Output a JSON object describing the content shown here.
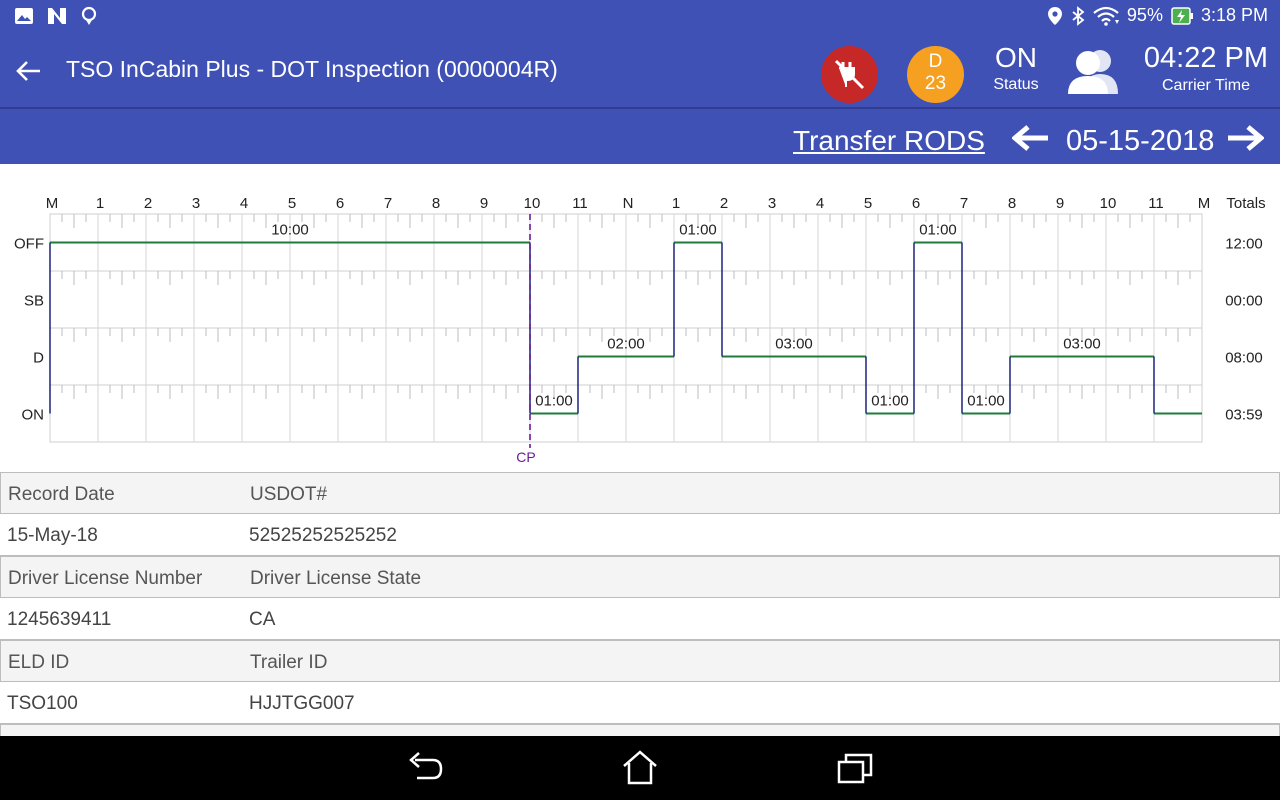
{
  "status_bar": {
    "left_icons": [
      "image-icon",
      "n-logo-icon",
      "location-pin-outline-icon"
    ],
    "battery": "95%",
    "time": "3:18 PM"
  },
  "app_bar": {
    "title": "TSO InCabin Plus - DOT Inspection (0000004R)",
    "duty_badge_top": "D",
    "duty_badge_bottom": "23",
    "status_value": "ON",
    "status_caption": "Status",
    "carrier_time": "04:22 PM",
    "carrier_caption": "Carrier Time"
  },
  "sub_bar": {
    "transfer_label": "Transfer RODS",
    "date": "05-15-2018"
  },
  "colors": {
    "primary": "#3f51b5",
    "alert": "#c62828",
    "duty_badge": "#f5a020",
    "line": "#1e7b3c",
    "vertical": "#1a237e",
    "cp_line": "#6a1b9a"
  },
  "chart_data": {
    "type": "line",
    "hour_labels": [
      "M",
      "1",
      "2",
      "3",
      "4",
      "5",
      "6",
      "7",
      "8",
      "9",
      "10",
      "11",
      "N",
      "1",
      "2",
      "3",
      "4",
      "5",
      "6",
      "7",
      "8",
      "9",
      "10",
      "11",
      "M"
    ],
    "totals_label": "Totals",
    "rows": [
      "OFF",
      "SB",
      "D",
      "ON"
    ],
    "totals": [
      "12:00",
      "00:00",
      "08:00",
      "03:59"
    ],
    "segments": [
      {
        "status": "OFF",
        "start": 0,
        "end": 10,
        "label": "10:00"
      },
      {
        "status": "ON",
        "start": 10,
        "end": 11,
        "label": "01:00"
      },
      {
        "status": "D",
        "start": 11,
        "end": 13,
        "label": "02:00"
      },
      {
        "status": "OFF",
        "start": 13,
        "end": 14,
        "label": "01:00"
      },
      {
        "status": "D",
        "start": 14,
        "end": 17,
        "label": "03:00"
      },
      {
        "status": "ON",
        "start": 17,
        "end": 18,
        "label": "01:00"
      },
      {
        "status": "OFF",
        "start": 18,
        "end": 19,
        "label": "01:00"
      },
      {
        "status": "ON",
        "start": 19,
        "end": 20,
        "label": "01:00"
      },
      {
        "status": "D",
        "start": 20,
        "end": 23,
        "label": "03:00"
      },
      {
        "status": "ON",
        "start": 23,
        "end": 24,
        "label": ""
      }
    ],
    "marker": {
      "hour": 10,
      "label": "CP"
    }
  },
  "info": {
    "record_date_label": "Record Date",
    "usdot_label": "USDOT#",
    "record_date": "15-May-18",
    "usdot": "52525252525252",
    "license_number_label": "Driver License Number",
    "license_state_label": "Driver License State",
    "license_number": "1245639411",
    "license_state": "CA",
    "eld_id_label": "ELD ID",
    "trailer_id_label": "Trailer ID",
    "eld_id": "TSO100",
    "trailer_id": "HJJTGG007"
  },
  "nav_bar": {
    "buttons": [
      "back-nav-icon",
      "home-nav-icon",
      "recents-nav-icon"
    ]
  }
}
